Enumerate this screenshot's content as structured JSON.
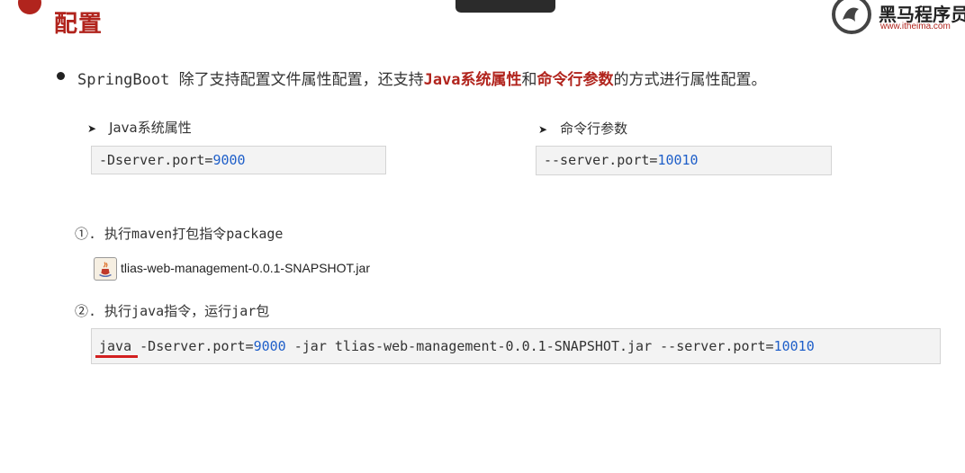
{
  "header": {
    "title": "配置",
    "logo_name": "黑马程序员",
    "logo_url": "www.itheima.com"
  },
  "intro": {
    "prefix": "SpringBoot 除了支持配置文件属性配置，还支持",
    "highlight1": "Java系统属性",
    "mid": "和",
    "highlight2": "命令行参数",
    "suffix": "的方式进行属性配置。"
  },
  "java_props": {
    "heading": "Java系统属性",
    "code_key": "-Dserver.port=",
    "code_value": "9000"
  },
  "cmd_args": {
    "heading": "命令行参数",
    "code_key": "--server.port=",
    "code_value": "10010"
  },
  "step1": {
    "label": "①. 执行maven打包指令package",
    "jar_file": "tlias-web-management-0.0.1-SNAPSHOT.jar"
  },
  "step2": {
    "label": "②. 执行java指令，运行jar包",
    "cmd_java": "java",
    "cmd_dport_key": " -Dserver.port=",
    "cmd_dport_value": "9000",
    "cmd_jar": " -jar tlias-web-management-0.0.1-SNAPSHOT.jar ",
    "cmd_sport_key": "--server.port=",
    "cmd_sport_value": "10010"
  },
  "colors": {
    "accent_red": "#b1241d",
    "number_blue": "#1f5fc9",
    "code_bg": "#f3f3f3"
  }
}
